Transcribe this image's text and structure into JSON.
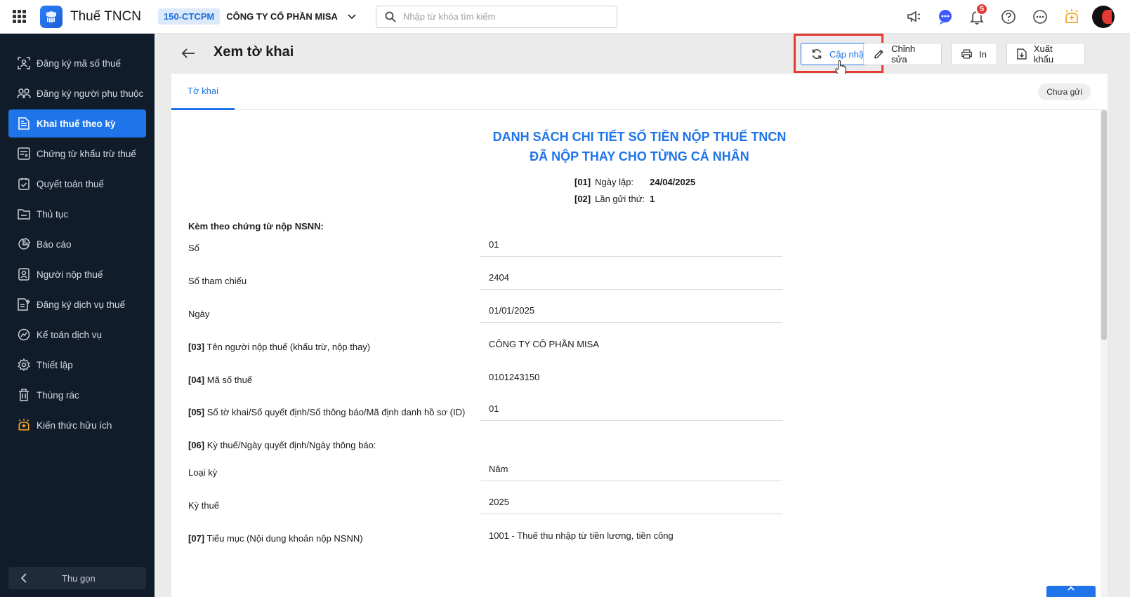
{
  "header": {
    "app_title": "Thuế TNCN",
    "company_code": "150-CTCPM",
    "company_name": "CÔNG TY CỔ PHẦN MISA",
    "search_placeholder": "Nhập từ khóa tìm kiếm",
    "notification_count": "5"
  },
  "sidebar": {
    "items": [
      {
        "label": "Đăng ký mã số thuế"
      },
      {
        "label": "Đăng ký người phụ thuộc"
      },
      {
        "label": "Khai thuế theo kỳ"
      },
      {
        "label": "Chứng từ khấu trừ thuế"
      },
      {
        "label": "Quyết toán thuế"
      },
      {
        "label": "Thủ tục"
      },
      {
        "label": "Báo cáo"
      },
      {
        "label": "Người nộp thuế"
      },
      {
        "label": "Đăng ký dịch vụ thuế"
      },
      {
        "label": "Kế toán dịch vụ"
      },
      {
        "label": "Thiết lập"
      },
      {
        "label": "Thùng rác"
      },
      {
        "label": "Kiến thức hữu ích"
      }
    ],
    "collapse_label": "Thu gọn"
  },
  "toolbar": {
    "page_title": "Xem tờ khai",
    "update_label": "Cập nhật",
    "edit_label": "Chỉnh sửa",
    "print_label": "In",
    "export_label": "Xuất khẩu"
  },
  "tabs": {
    "declaration": "Tờ khai",
    "status": "Chưa gửi"
  },
  "document": {
    "title_line1": "DANH SÁCH CHI TIẾT SỐ TIỀN NỘP THUẾ TNCN",
    "title_line2": "ĐÃ NỘP THAY CHO TỪNG CÁ NHÂN",
    "meta": [
      {
        "code": "[01]",
        "label": "Ngày lập:",
        "value": "24/04/2025"
      },
      {
        "code": "[02]",
        "label": "Lần gửi thứ:",
        "value": "1"
      }
    ],
    "section_attached": "Kèm theo chứng từ nộp NSNN:",
    "rows": [
      {
        "code": "",
        "label": "Số",
        "value": "01"
      },
      {
        "code": "",
        "label": "Số tham chiếu",
        "value": "2404"
      },
      {
        "code": "",
        "label": "Ngày",
        "value": "01/01/2025"
      },
      {
        "code": "[03]",
        "label": "Tên người nộp thuế (khấu trừ, nộp thay)",
        "value": "CÔNG TY CÔ PHẦN MISA"
      },
      {
        "code": "[04]",
        "label": "Mã số thuế",
        "value": "0101243150"
      },
      {
        "code": "[05]",
        "label": "Số tờ khai/Số quyết định/Số thông báo/Mã định danh hồ sơ (ID)",
        "value": "01"
      },
      {
        "code": "[06]",
        "label": "Kỳ thuế/Ngày quyết định/Ngày thông báo:",
        "value": ""
      },
      {
        "code": "",
        "label": "Loại kỳ",
        "value": "Năm"
      },
      {
        "code": "",
        "label": "Kỳ thuế",
        "value": "2025"
      },
      {
        "code": "[07]",
        "label": "Tiểu mục (Nội dung khoản nộp NSNN)",
        "value": "1001 - Thuế thu nhập từ tiền lương, tiền công"
      }
    ]
  },
  "colors": {
    "accent": "#1e74e8",
    "sidebar_bg": "#111c2b",
    "highlight": "#e53935"
  }
}
